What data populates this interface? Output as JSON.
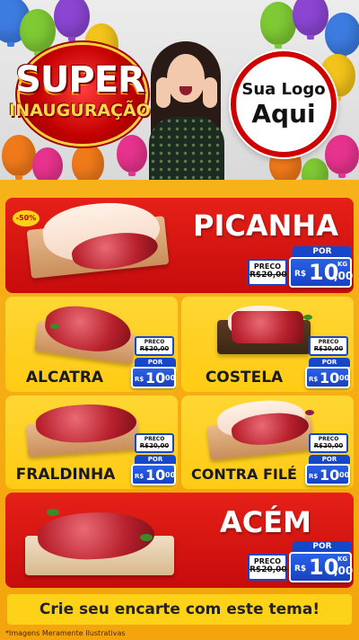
{
  "header": {
    "title_line1": "SUPER",
    "title_line2": "INAUGURAÇÃO",
    "logo_line1": "Sua Logo",
    "logo_line2": "Aqui"
  },
  "colors": {
    "red": "#d10000",
    "yellow": "#ffd21a",
    "orange": "#f4a40c",
    "blue": "#1747c9"
  },
  "products": [
    {
      "name": "PICANHA",
      "badge": "-50%",
      "preco_label": "PRECO",
      "old_price": "R$20,00",
      "por_label": "POR",
      "currency": "R$",
      "price_int": "10",
      "price_dec": ",00",
      "unit": "KG"
    },
    {
      "name": "ALCATRA",
      "preco_label": "PRECO",
      "old_price": "R$20,00",
      "por_label": "POR",
      "currency": "R$",
      "price_int": "10",
      "price_dec": ",00"
    },
    {
      "name": "COSTELA",
      "preco_label": "PRECO",
      "old_price": "R$20,00",
      "por_label": "POR",
      "currency": "R$",
      "price_int": "10",
      "price_dec": ",00"
    },
    {
      "name": "FRALDINHA",
      "preco_label": "PRECO",
      "old_price": "R$20,00",
      "por_label": "POR",
      "currency": "R$",
      "price_int": "10",
      "price_dec": ",00"
    },
    {
      "name": "CONTRA FILÉ",
      "preco_label": "PRECO",
      "old_price": "R$20,00",
      "por_label": "POR",
      "currency": "R$",
      "price_int": "10",
      "price_dec": ",00"
    },
    {
      "name": "ACÉM",
      "preco_label": "PRECO",
      "old_price": "R$20,00",
      "por_label": "POR",
      "currency": "R$",
      "price_int": "10",
      "price_dec": ",00",
      "unit": "KG"
    }
  ],
  "cta": "Crie seu encarte com este tema!",
  "footnote": "*Imagens Meramente Ilustrativas"
}
